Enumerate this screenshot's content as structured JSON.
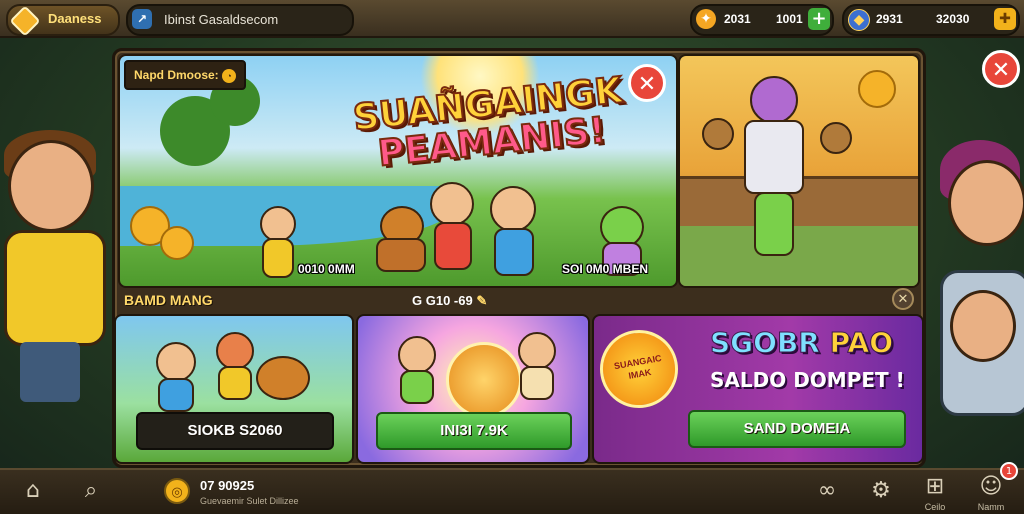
{
  "topbar": {
    "logo_label": "Daaness",
    "site_text": "Ibinst Gasaldsecom",
    "resource1": {
      "icon": "leaf-coin-icon",
      "value_a": "2031",
      "value_b": "1001"
    },
    "resource2": {
      "icon": "gem-coin-icon",
      "value_a": "2931",
      "value_b": "32030"
    }
  },
  "hero": {
    "tag": "Napd Dmoose:",
    "title_line1": "SUAÑGAINGK",
    "title_line2": "PEAMANIS!",
    "caption_left": "0010 0MM",
    "caption_right": "SOI 0M0 MBEN"
  },
  "section": {
    "label": "BAMD MANG",
    "timer": "G G10 -69"
  },
  "cards": [
    {
      "button": "SIOKB S2060"
    },
    {
      "button": "INI3I 7.9K"
    },
    {
      "title_a": "SGOBR",
      "title_b": "PAO",
      "subtitle": "SALDO DOMPET !",
      "badge_top": "SUANGAIC",
      "badge_bottom": "IMAK",
      "button": "SAND DOMEIA"
    }
  ],
  "bottombar": {
    "coin_value": "07 90925",
    "coin_sub": "Guevaemir Sulet Dillizee",
    "label_a": "Ceilo",
    "label_b": "Namm",
    "notif": "1"
  },
  "colors": {
    "accent": "#f2b21b",
    "danger": "#e8463a",
    "success": "#3fae3b"
  }
}
